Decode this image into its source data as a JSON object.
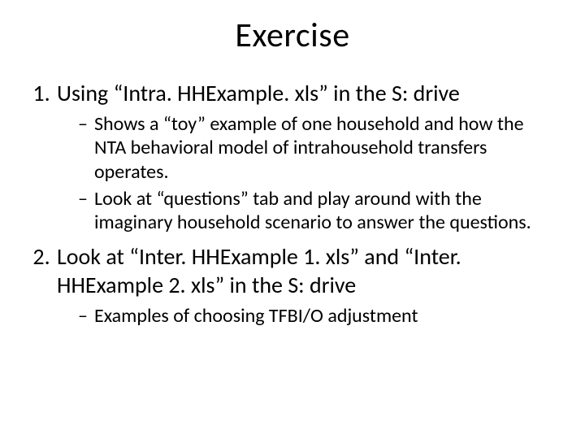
{
  "title": "Exercise",
  "items": [
    {
      "text": "Using “Intra. HHExample. xls” in the S: drive",
      "sub": [
        "Shows a “toy” example of one household and how the NTA behavioral model of intrahousehold transfers operates.",
        "Look at “questions” tab and play around with the imaginary household scenario to answer the questions."
      ]
    },
    {
      "text": "Look at “Inter. HHExample 1. xls” and “Inter. HHExample 2. xls” in the S: drive",
      "sub": [
        "Examples of choosing TFBI/O adjustment"
      ]
    }
  ]
}
